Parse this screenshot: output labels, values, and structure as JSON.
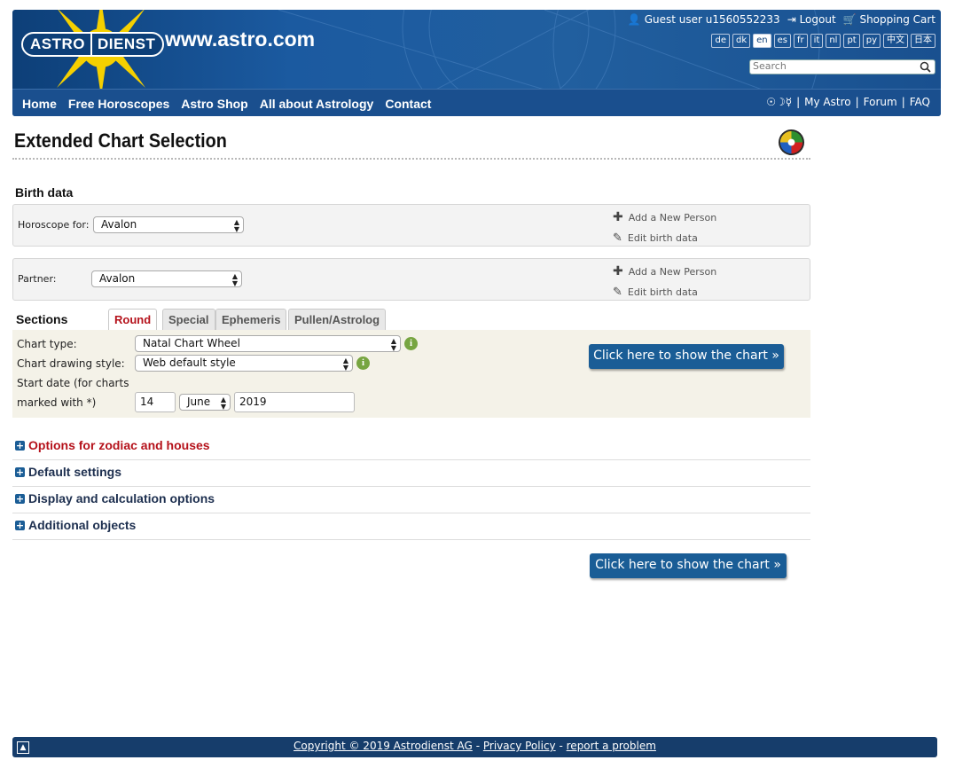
{
  "header": {
    "logo_left": "ASTRO",
    "logo_right": "DIENST",
    "site_url": "www.astro.com",
    "user": "Guest user u1560552233",
    "logout": "Logout",
    "cart": "Shopping Cart",
    "languages": [
      "de",
      "dk",
      "en",
      "es",
      "fr",
      "it",
      "nl",
      "pt",
      "ру",
      "中文",
      "日本"
    ],
    "active_language": "en",
    "search_placeholder": "Search"
  },
  "nav": {
    "items": [
      "Home",
      "Free Horoscopes",
      "Astro Shop",
      "All about Astrology",
      "Contact"
    ],
    "right_symbols": "☉☽☿",
    "my_astro": "My Astro",
    "forum": "Forum",
    "faq": "FAQ",
    "sep": "|"
  },
  "page": {
    "title": "Extended Chart Selection"
  },
  "birth_data": {
    "heading": "Birth data",
    "horoscope_label": "Horoscope for:",
    "horoscope_value": "Avalon",
    "partner_label": "Partner:",
    "partner_value": "Avalon",
    "add_person": "Add a New Person",
    "edit_birth": "Edit birth data"
  },
  "sections": {
    "heading": "Sections",
    "tabs": [
      "Round",
      "Special",
      "Ephemeris",
      "Pullen/Astrolog"
    ],
    "active_tab": "Round",
    "chart_type_label": "Chart type:",
    "chart_type_value": "Natal Chart Wheel",
    "drawing_style_label": "Chart drawing style:",
    "drawing_style_value": "Web default style",
    "start_date_label_1": "Start date (for charts",
    "start_date_label_2": "marked with *)",
    "day": "14",
    "month": "June",
    "year": "2019",
    "show_chart_button": "Click here to show the chart »",
    "info_glyph": "i"
  },
  "accordion": [
    "Options for zodiac and houses",
    "Default settings",
    "Display and calculation options",
    "Additional objects"
  ],
  "bottom_button": "Click here to show the chart »",
  "footer": {
    "copyright": "Copyright © 2019 Astrodienst AG",
    "privacy": "Privacy Policy",
    "report": "report a problem",
    "dash": "-"
  },
  "colors": {
    "header_blue": "#1a4f8e",
    "button_blue": "#1a5d96",
    "active_red": "#b5121b",
    "info_green": "#77a541",
    "panel_beige": "#f4f2e8"
  }
}
